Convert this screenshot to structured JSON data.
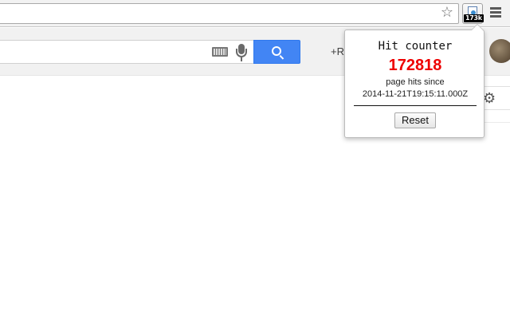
{
  "toolbar": {
    "icons": {
      "star": "star-icon",
      "menu": "hamburger-menu-icon"
    },
    "extension": {
      "badge": "173k",
      "icon": "hit-counter-extension-icon"
    }
  },
  "page": {
    "header": {
      "plus_link": "+R"
    },
    "icons": {
      "keyboard": "keyboard-icon",
      "mic": "microphone-icon",
      "search": "search-icon",
      "gear": "gear-icon"
    }
  },
  "popup": {
    "title": "Hit counter",
    "count": "172818",
    "since_label": "page hits since",
    "since_date": "2014-11-21T19:15:11.000Z",
    "reset_label": "Reset",
    "colors": {
      "count": "#ee0000"
    }
  },
  "colors": {
    "search_button": "#4285f4"
  }
}
